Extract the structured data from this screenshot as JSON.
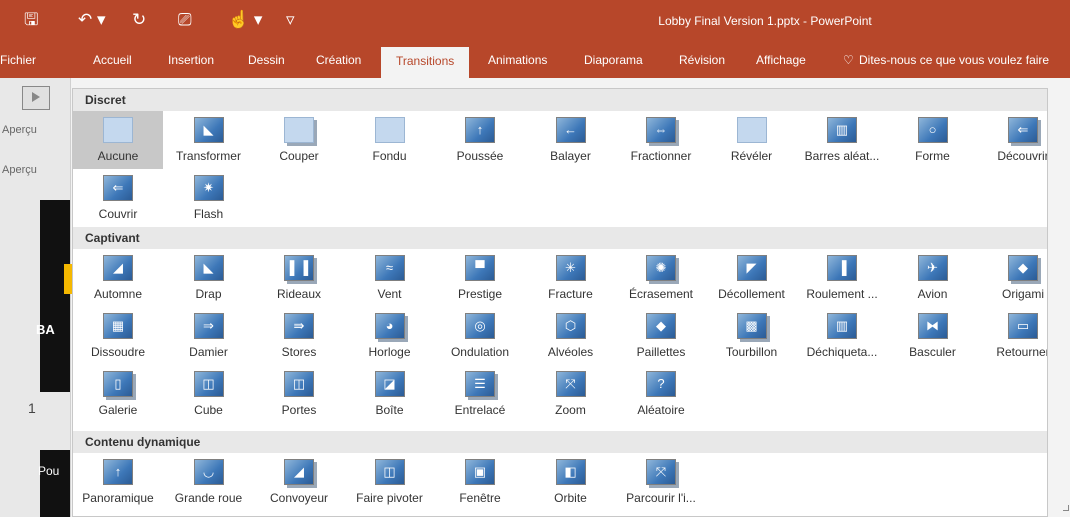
{
  "window": {
    "title": "Lobby Final Version 1.pptx - PowerPoint",
    "qat": [
      {
        "name": "save-icon",
        "glyph": "🖫"
      },
      {
        "name": "undo-icon",
        "glyph": "↶ ▾"
      },
      {
        "name": "redo-icon",
        "glyph": "↻"
      },
      {
        "name": "presenter-icon",
        "glyph": "⎚"
      },
      {
        "name": "touch-mode-icon",
        "glyph": "☝ ▾"
      },
      {
        "name": "customize-qat-icon",
        "glyph": "▿"
      }
    ]
  },
  "tabs": [
    {
      "label": "Fichier",
      "active": false
    },
    {
      "label": "Accueil",
      "active": false
    },
    {
      "label": "Insertion",
      "active": false
    },
    {
      "label": "Dessin",
      "active": false
    },
    {
      "label": "Création",
      "active": false
    },
    {
      "label": "Transitions",
      "active": true
    },
    {
      "label": "Animations",
      "active": false
    },
    {
      "label": "Diaporama",
      "active": false
    },
    {
      "label": "Révision",
      "active": false
    },
    {
      "label": "Affichage",
      "active": false
    }
  ],
  "tell_me": {
    "icon": "lightbulb-icon",
    "glyph": "♡",
    "text": "Dites-nous ce que vous voulez faire"
  },
  "left_pane": {
    "preview_button_label": "Aperçu",
    "group_label": "Aperçu",
    "slide_number": "1",
    "slide_text_1": "BA",
    "slide_text_2": "Pou"
  },
  "colors": {
    "accent": "#b7472a",
    "selected": "#c8c8c8",
    "section": "#e8e8e8"
  },
  "gallery": {
    "sections": [
      {
        "title": "Discret",
        "items": [
          {
            "label": "Aucune",
            "glyph": "",
            "selected": true
          },
          {
            "label": "Transformer",
            "glyph": "◣"
          },
          {
            "label": "Couper",
            "glyph": ""
          },
          {
            "label": "Fondu",
            "glyph": ""
          },
          {
            "label": "Poussée",
            "glyph": "↑"
          },
          {
            "label": "Balayer",
            "glyph": "←"
          },
          {
            "label": "Fractionner",
            "glyph": "⇔"
          },
          {
            "label": "Révéler",
            "glyph": ""
          },
          {
            "label": "Barres aléat...",
            "glyph": "▥"
          },
          {
            "label": "Forme",
            "glyph": "○"
          },
          {
            "label": "Découvrir",
            "glyph": "⇐"
          },
          {
            "label": "Couvrir",
            "glyph": "⇐"
          },
          {
            "label": "Flash",
            "glyph": "✷"
          }
        ]
      },
      {
        "title": "Captivant",
        "items": [
          {
            "label": "Automne",
            "glyph": "◢"
          },
          {
            "label": "Drap",
            "glyph": "◣"
          },
          {
            "label": "Rideaux",
            "glyph": "▌▐"
          },
          {
            "label": "Vent",
            "glyph": "≈"
          },
          {
            "label": "Prestige",
            "glyph": "▀"
          },
          {
            "label": "Fracture",
            "glyph": "✳"
          },
          {
            "label": "Écrasement",
            "glyph": "✺"
          },
          {
            "label": "Décollement",
            "glyph": "◤"
          },
          {
            "label": "Roulement ...",
            "glyph": "▐"
          },
          {
            "label": "Avion",
            "glyph": "✈"
          },
          {
            "label": "Origami",
            "glyph": "◆"
          },
          {
            "label": "Dissoudre",
            "glyph": "▦"
          },
          {
            "label": "Damier",
            "glyph": "⇒"
          },
          {
            "label": "Stores",
            "glyph": "⇛"
          },
          {
            "label": "Horloge",
            "glyph": "◕"
          },
          {
            "label": "Ondulation",
            "glyph": "◎"
          },
          {
            "label": "Alvéoles",
            "glyph": "⬡"
          },
          {
            "label": "Paillettes",
            "glyph": "◆"
          },
          {
            "label": "Tourbillon",
            "glyph": "▩"
          },
          {
            "label": "Déchiqueta...",
            "glyph": "▥"
          },
          {
            "label": "Basculer",
            "glyph": "⧓"
          },
          {
            "label": "Retourner",
            "glyph": "▭"
          },
          {
            "label": "Galerie",
            "glyph": "▯"
          },
          {
            "label": "Cube",
            "glyph": "◫"
          },
          {
            "label": "Portes",
            "glyph": "◫"
          },
          {
            "label": "Boîte",
            "glyph": "◪"
          },
          {
            "label": "Entrelacé",
            "glyph": "☰"
          },
          {
            "label": "Zoom",
            "glyph": "⤧"
          },
          {
            "label": "Aléatoire",
            "glyph": "?"
          }
        ]
      },
      {
        "title": "Contenu dynamique",
        "items": [
          {
            "label": "Panoramique",
            "glyph": "↑"
          },
          {
            "label": "Grande roue",
            "glyph": "◡"
          },
          {
            "label": "Convoyeur",
            "glyph": "◢"
          },
          {
            "label": "Faire pivoter",
            "glyph": "◫"
          },
          {
            "label": "Fenêtre",
            "glyph": "▣"
          },
          {
            "label": "Orbite",
            "glyph": "◧"
          },
          {
            "label": "Parcourir l'i...",
            "glyph": "⤧"
          }
        ]
      }
    ]
  }
}
